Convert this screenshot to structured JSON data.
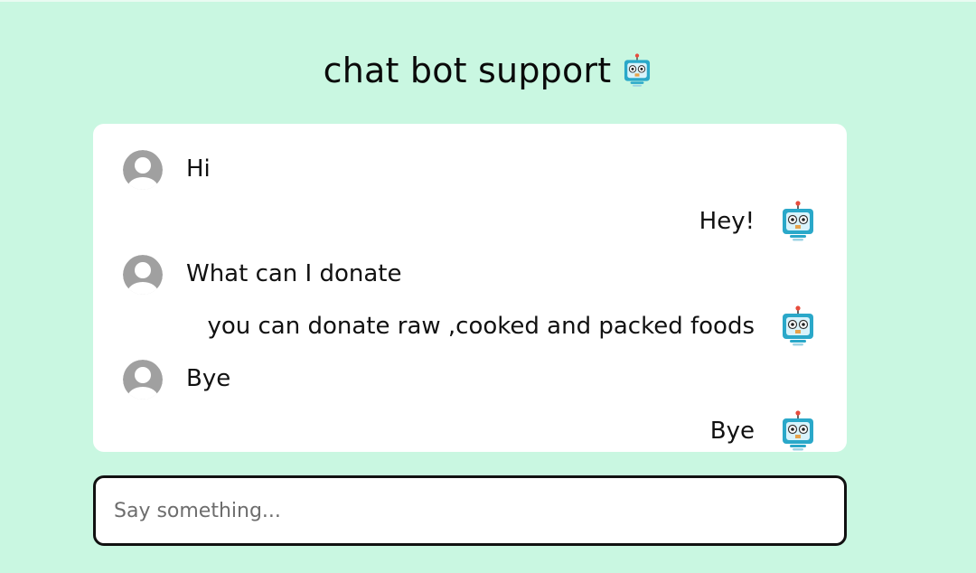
{
  "header": {
    "title": "chat bot support",
    "title_icon": "robot-icon"
  },
  "messages": [
    {
      "sender": "user",
      "text": "Hi"
    },
    {
      "sender": "bot",
      "text": "Hey!"
    },
    {
      "sender": "user",
      "text": "What can I donate"
    },
    {
      "sender": "bot",
      "text": "you can donate raw ,cooked and packed foods"
    },
    {
      "sender": "user",
      "text": "Bye"
    },
    {
      "sender": "bot",
      "text": "Bye"
    }
  ],
  "composer": {
    "placeholder": "Say something...",
    "value": ""
  },
  "icons": {
    "user_avatar": "user-avatar-icon",
    "bot_avatar": "robot-icon"
  },
  "colors": {
    "background": "#c9f7e1",
    "chat_panel": "#ffffff",
    "robot_screen": "#29b6d8",
    "robot_antenna": "#e74c3c",
    "avatar_gray": "#9e9e9e"
  }
}
